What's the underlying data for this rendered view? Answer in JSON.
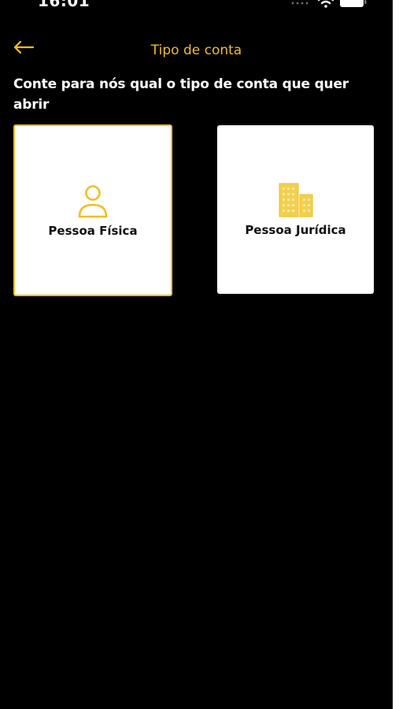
{
  "status_bar": {
    "time": "16:01"
  },
  "header": {
    "title": "Tipo de conta"
  },
  "prompt": "Conte para nós qual o tipo de conta que quer abrir",
  "options": [
    {
      "label": "Pessoa Física",
      "icon": "person-icon",
      "selected": true
    },
    {
      "label": "Pessoa Jurídica",
      "icon": "building-icon",
      "selected": false
    }
  ],
  "colors": {
    "accent": "#f2be22",
    "background": "#000000",
    "card": "#ffffff"
  }
}
